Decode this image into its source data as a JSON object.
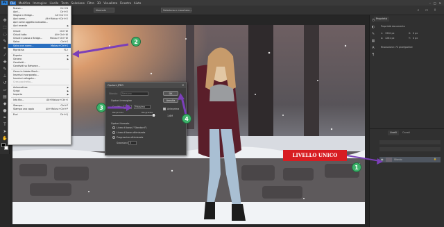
{
  "menubar": {
    "logo": "Ps",
    "items": [
      "File",
      "Modifica",
      "Immagine",
      "Livello",
      "Testo",
      "Selezione",
      "Filtro",
      "3D",
      "Visualizza",
      "Finestra",
      "Aiuto"
    ]
  },
  "optbar": {
    "chip1": "Normale",
    "chip2": "Seleziona e maschera..."
  },
  "doc": {
    "tab": "Snow_girl.jpg @ 33,3% (RGB/8)"
  },
  "file_menu": {
    "items": [
      {
        "label": "Nuovo...",
        "shortcut": "Ctrl+N"
      },
      {
        "label": "Apri...",
        "shortcut": "Ctrl+O"
      },
      {
        "label": "Sfoglia in Bridge...",
        "shortcut": "Alt+Ctrl+O"
      },
      {
        "label": "Apri come...",
        "shortcut": "Alt+Maiusc+Ctrl+O"
      },
      {
        "label": "Apri come oggetto avanzato...",
        "shortcut": ""
      },
      {
        "label": "Apri recente",
        "shortcut": "",
        "submenu": true
      },
      {
        "label": "Chiudi",
        "shortcut": "Ctrl+W"
      },
      {
        "label": "Chiudi tutto",
        "shortcut": "Alt+Ctrl+W"
      },
      {
        "label": "Chiudi e passa a Bridge...",
        "shortcut": "Maiusc+Ctrl+W"
      },
      {
        "label": "Salva",
        "shortcut": "Ctrl+S"
      },
      {
        "label": "Salva con nome...",
        "shortcut": "Maiusc+Ctrl+S",
        "highlight": true
      },
      {
        "label": "Ripristina",
        "shortcut": "F12"
      },
      {
        "label": "Esporta",
        "shortcut": "",
        "submenu": true
      },
      {
        "label": "Genera",
        "shortcut": "",
        "submenu": true
      },
      {
        "label": "Condividi...",
        "shortcut": ""
      },
      {
        "label": "Condividi su Behance...",
        "shortcut": ""
      },
      {
        "label": "Cerca in Adobe Stock...",
        "shortcut": ""
      },
      {
        "label": "Inserisci incorporato...",
        "shortcut": ""
      },
      {
        "label": "Inserisci collegato...",
        "shortcut": ""
      },
      {
        "label": "Crea pacchetto...",
        "shortcut": "",
        "disabled": true
      },
      {
        "label": "Automatizza",
        "shortcut": "",
        "submenu": true
      },
      {
        "label": "Script",
        "shortcut": "",
        "submenu": true
      },
      {
        "label": "Importa",
        "shortcut": "",
        "submenu": true
      },
      {
        "label": "Info file...",
        "shortcut": "Alt+Maiusc+Ctrl+I"
      },
      {
        "label": "Stampa...",
        "shortcut": "Ctrl+P"
      },
      {
        "label": "Stampa una copia",
        "shortcut": "Alt+Maiusc+Ctrl+P"
      },
      {
        "label": "Esci",
        "shortcut": "Ctrl+Q"
      }
    ]
  },
  "dialog": {
    "title": "Opzioni JPEG",
    "matte_label": "Sfondo:",
    "matte_value": "Nessuno",
    "image_options": "Opzioni immagine",
    "quality_label": "Qualità:",
    "quality_value": "12",
    "quality_preset": "Massima",
    "small_file": "file piccolo",
    "large_file": "file grande",
    "format_options": "Opzioni formato",
    "baseline_std": "Linea di base (\"Standard\")",
    "baseline_opt": "Linea di base ottimizzata",
    "progressive": "Progressiva ottimizzata",
    "scans_label": "Scansioni:",
    "scans_value": "3",
    "ok": "OK",
    "cancel": "Annulla",
    "preview": "Anteprima",
    "size": "1,6M"
  },
  "right_panel": {
    "properties_tab": "Proprietà",
    "doc_props": "Proprietà documento",
    "w_label": "L:",
    "w_value": "1920 px",
    "h_label": "A:",
    "h_value": "1281 px",
    "x_label": "X:",
    "x_value": "0 px",
    "y_label": "Y:",
    "y_value": "0 px",
    "resolution": "Risoluzione: 72 pixel/pollice",
    "layers_tab": "Livelli",
    "channels_tab": "Canali",
    "layer_name": "Sfondo"
  },
  "annotations": {
    "badge1": "1",
    "badge2": "2",
    "badge3": "3",
    "badge4": "4",
    "label": "LIVELLO UNICO",
    "arrow_color": "#7b3fb8",
    "badge_color": "#3db26a"
  }
}
